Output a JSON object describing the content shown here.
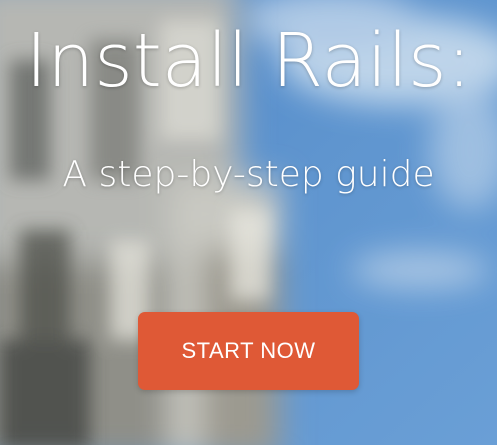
{
  "hero": {
    "title": "Install Rails:",
    "subtitle": "A step-by-step guide",
    "cta_label": "START NOW"
  },
  "colors": {
    "cta_background": "#df5936",
    "text": "#ffffff",
    "sky": "#5d8fc8"
  }
}
